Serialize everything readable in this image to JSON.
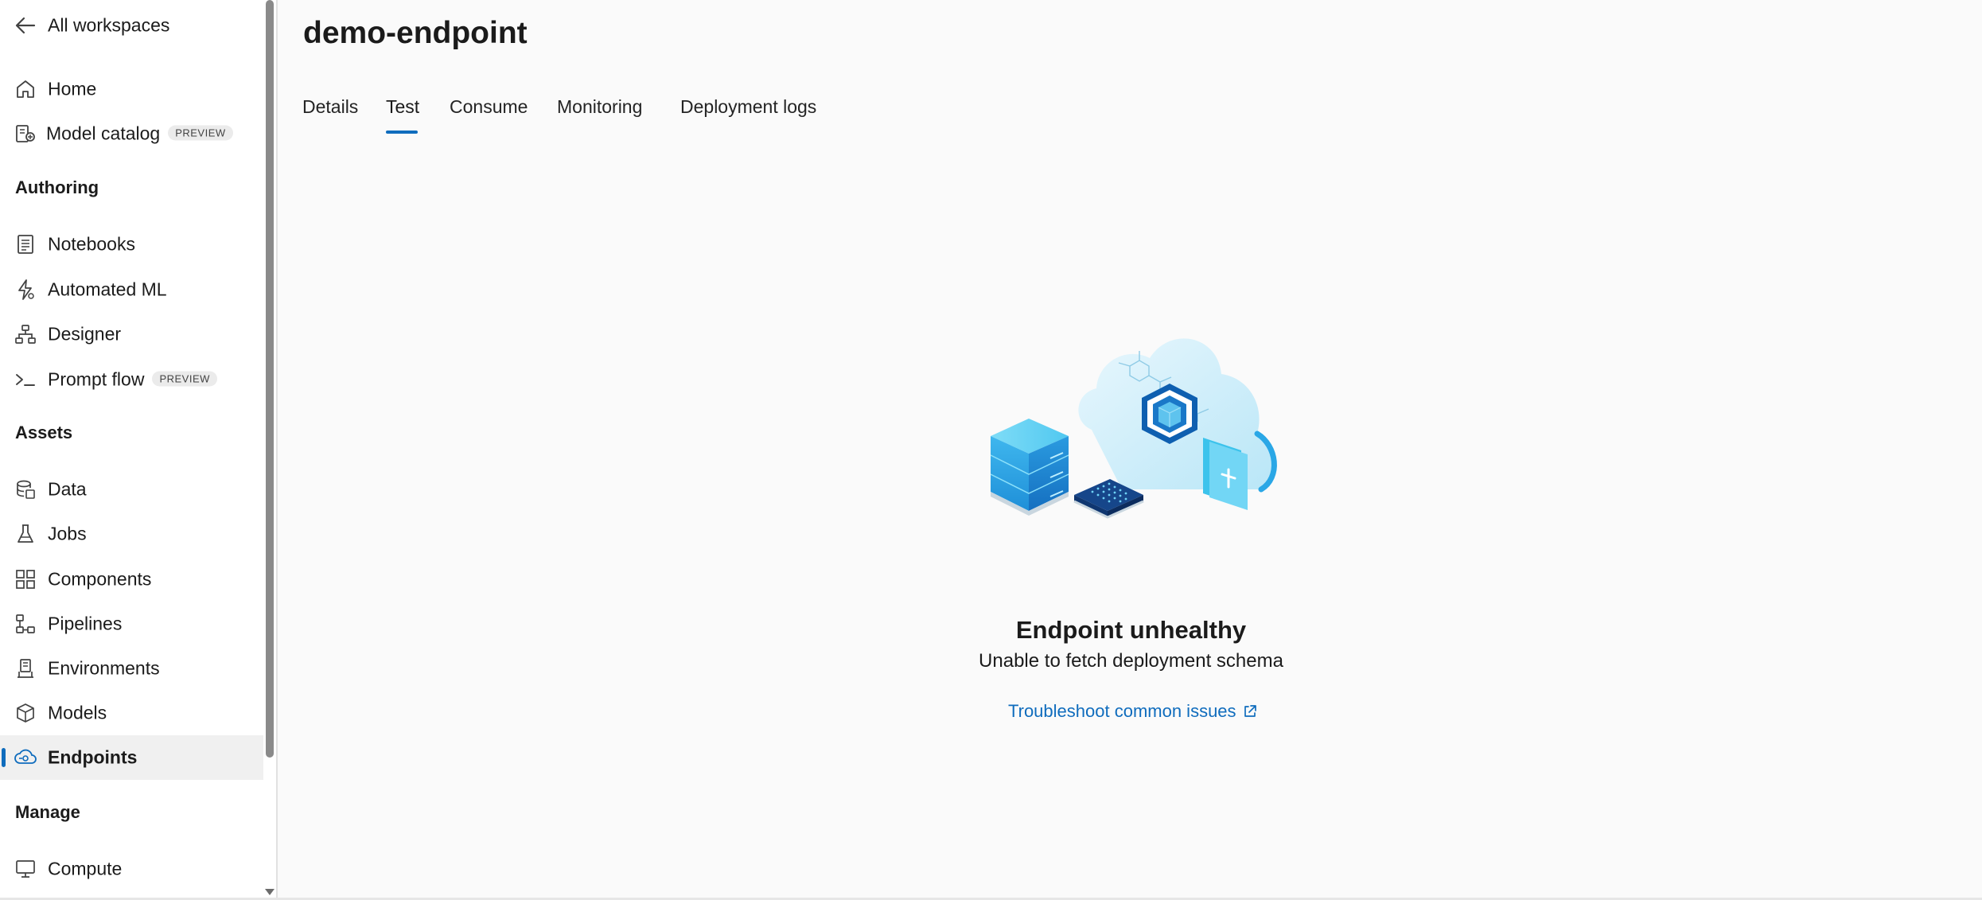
{
  "nav": {
    "back_label": "All workspaces",
    "home": "Home",
    "model_catalog": "Model catalog",
    "model_catalog_badge": "PREVIEW",
    "sections": {
      "authoring": "Authoring",
      "assets": "Assets",
      "manage": "Manage"
    },
    "authoring_items": [
      "Notebooks",
      "Automated ML",
      "Designer",
      "Prompt flow"
    ],
    "prompt_flow_badge": "PREVIEW",
    "assets_items": [
      "Data",
      "Jobs",
      "Components",
      "Pipelines",
      "Environments",
      "Models",
      "Endpoints"
    ],
    "manage_items": [
      "Compute"
    ],
    "selected": "Endpoints"
  },
  "page": {
    "title": "demo-endpoint",
    "tabs": [
      "Details",
      "Test",
      "Consume",
      "Monitoring",
      "Deployment logs"
    ],
    "active_tab": "Test"
  },
  "empty_state": {
    "title": "Endpoint unhealthy",
    "subtitle": "Unable to fetch deployment schema",
    "link": "Troubleshoot common issues"
  },
  "colors": {
    "accent": "#0f6cbd",
    "selected_bg": "#f0f0f0"
  }
}
